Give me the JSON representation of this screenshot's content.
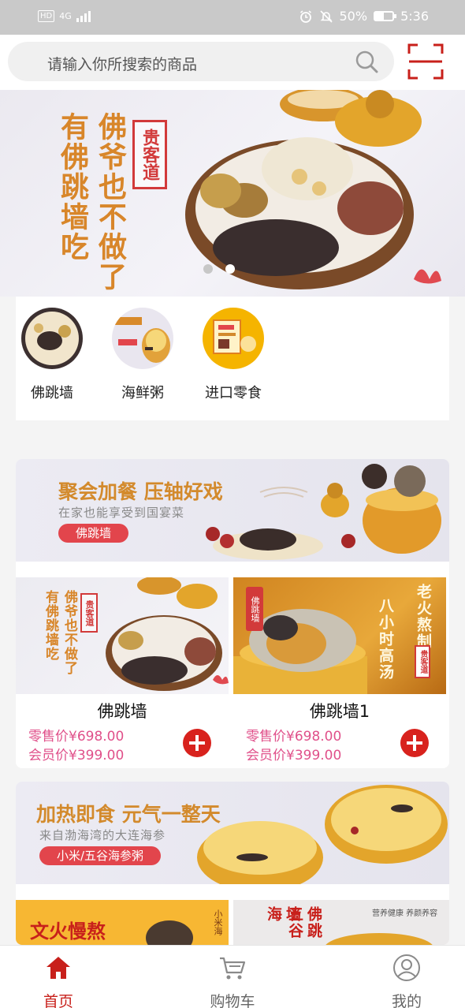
{
  "status_bar": {
    "network": "HD",
    "net_type": "4G",
    "battery": "50%",
    "battery_level": 0.5,
    "time": "5:36"
  },
  "search": {
    "placeholder": "请输入你所搜索的商品"
  },
  "banner": {
    "line1": "佛爷也不做了",
    "line2": "有佛跳墙吃",
    "stamp": "贵客道",
    "slide_count": 2,
    "active_slide": 1
  },
  "categories": [
    {
      "label": "佛跳墙",
      "icon": "buddha-jumps-wall-dish"
    },
    {
      "label": "海鲜粥",
      "icon": "seafood-porridge"
    },
    {
      "label": "进口零食",
      "icon": "imported-snacks"
    }
  ],
  "sections": [
    {
      "banner_title": "聚会加餐 压轴好戏",
      "banner_subtitle": "在家也能享受到国宴菜",
      "banner_tag": "佛跳墙",
      "products": [
        {
          "name": "佛跳墙",
          "retail_label": "零售价",
          "retail_price": "¥698.00",
          "member_label": "会员价",
          "member_price": "¥399.00",
          "img_text_a": "佛爷也不做了",
          "img_text_b": "有佛跳墙吃",
          "img_stamp": "贵客道"
        },
        {
          "name": "佛跳墙1",
          "retail_label": "零售价",
          "retail_price": "¥698.00",
          "member_label": "会员价",
          "member_price": "¥399.00",
          "img_text_a": "老火熬制",
          "img_text_b": "八小时高汤",
          "img_tag": "佛跳墙",
          "img_stamp": "贵客道"
        }
      ]
    },
    {
      "banner_title": "加热即食 元气一整天",
      "banner_subtitle": "来自渤海湾的大连海参",
      "banner_tag": "小米/五谷海参粥",
      "products": [
        {
          "img_text_a": "文火慢熬",
          "img_text_b": "小米海"
        },
        {
          "img_text_a": "佛跳墙",
          "img_text_b": "五谷海",
          "img_note": "营养健康 养颜养容"
        }
      ]
    }
  ],
  "tabs": [
    {
      "label": "首页",
      "icon": "home-icon",
      "active": true
    },
    {
      "label": "购物车",
      "icon": "cart-icon",
      "active": false
    },
    {
      "label": "我的",
      "icon": "profile-icon",
      "active": false
    }
  ],
  "colors": {
    "accent": "#c8201b",
    "price": "#e0508a",
    "gold_text": "#d8862a",
    "status_bar": "#c9c9c9"
  }
}
